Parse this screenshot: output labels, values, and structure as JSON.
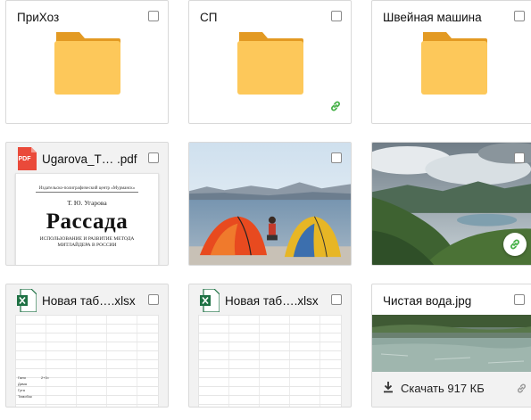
{
  "folders": [
    {
      "name": "ПриХоз"
    },
    {
      "name": "СП"
    },
    {
      "name": "Швейная машина"
    }
  ],
  "pdf": {
    "name": "Ugarova_T…  .pdf",
    "icon_label": "PDF",
    "publisher": "Издательско-полиграфический центр «Мурманск»",
    "author": "Т. Ю. Угарова",
    "title": "Рассада",
    "subtitle": "ИСПОЛЬЗОВАНИЕ И РАЗВИТИЕ МЕТОДА МИТЛАЙДЕРА В РОССИИ"
  },
  "xlsx1": {
    "name": "Новая таб….xlsx",
    "cells": [
      "Галя",
      "Дима",
      "Гутя",
      "Тимобок"
    ],
    "cell2": "2+3="
  },
  "xlsx2": {
    "name": "Новая таб….xlsx"
  },
  "jpg": {
    "name": "Чистая вода.jpg",
    "download_label": "Скачать 917 КБ"
  },
  "icons": {
    "folder": "folder-icon",
    "link": "link-icon",
    "download": "download-icon",
    "pdf": "pdf-icon",
    "excel": "excel-icon"
  },
  "colors": {
    "folder": "#fdc85a",
    "folder_tab": "#e39a23",
    "link_green": "#48b24a",
    "pdf_red": "#ea4a3a",
    "excel_green": "#1e7144"
  }
}
